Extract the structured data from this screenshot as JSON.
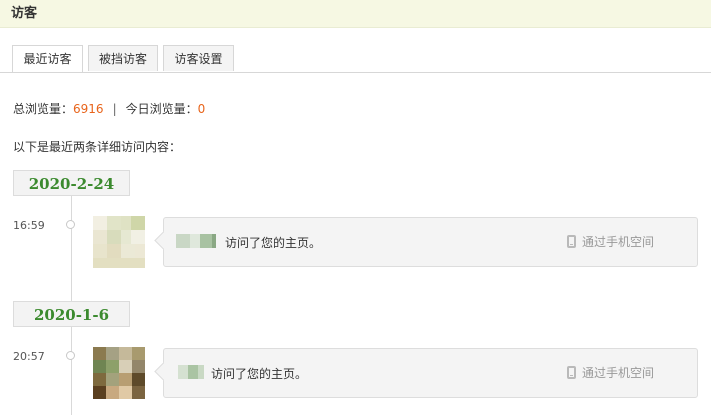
{
  "header": {
    "title": "访客"
  },
  "tabs": [
    {
      "label": "最近访客",
      "active": true
    },
    {
      "label": "被挡访客",
      "active": false
    },
    {
      "label": "访客设置",
      "active": false
    }
  ],
  "stats": {
    "total_label": "总浏览量：",
    "total_value": "6916",
    "separator": "|",
    "today_label": "今日浏览量：",
    "today_value": "0"
  },
  "intro": "以下是最近两条详细访问内容：",
  "visits": [
    {
      "date": "2020-2-24",
      "time": "16:59",
      "action": "访问了您的主页。",
      "device": "通过手机空间",
      "device_icon": "phone-icon"
    },
    {
      "date": "2020-1-6",
      "time": "20:57",
      "action": "访问了您的主页。",
      "device": "通过手机空间",
      "device_icon": "phone-icon"
    }
  ],
  "colors": {
    "header_bg": "#f6f8e3",
    "accent_number": "#e8641b",
    "date_text": "#3b8a2e"
  }
}
